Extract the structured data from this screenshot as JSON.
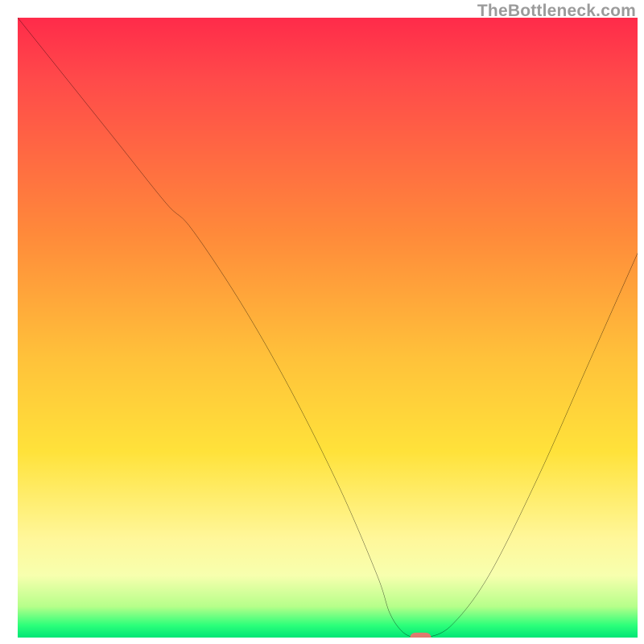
{
  "watermark": {
    "text": "TheBottleneck.com"
  },
  "chart_data": {
    "type": "line",
    "title": "",
    "xlabel": "",
    "ylabel": "",
    "xlim": [
      0,
      100
    ],
    "ylim": [
      0,
      100
    ],
    "grid": false,
    "legend": false,
    "series": [
      {
        "name": "bottleneck-curve",
        "x": [
          0,
          8,
          16,
          24,
          28,
          36,
          44,
          52,
          58,
          60,
          62,
          64,
          66,
          70,
          76,
          84,
          92,
          100
        ],
        "y": [
          100,
          90,
          80,
          70,
          66,
          54,
          40,
          24,
          10,
          4,
          1,
          0,
          0,
          2,
          10,
          26,
          44,
          62
        ]
      }
    ],
    "marker": {
      "name": "optimal-point",
      "x": 65,
      "y": 0,
      "color": "#e07a6f",
      "shape": "pill"
    },
    "background_gradient": {
      "top": "#ff2b4a",
      "middle": "#ffd23a",
      "bottom": "#00e676"
    }
  }
}
